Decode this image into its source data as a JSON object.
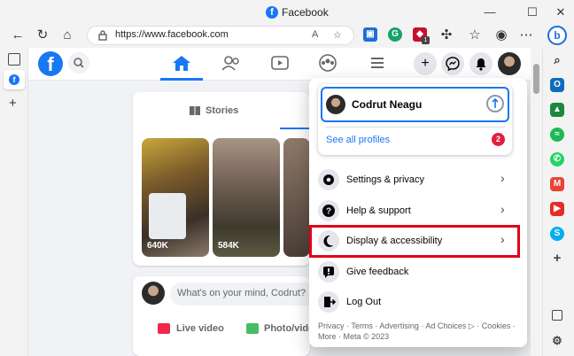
{
  "window": {
    "title": "Facebook",
    "controls": {
      "minimize": "—",
      "maximize": "☐",
      "close": "✕"
    }
  },
  "browser": {
    "url": "https://www.facebook.com",
    "reader_icon": "A",
    "ext_badge": "1"
  },
  "facebook": {
    "logo": "f",
    "stories": {
      "tab_label": "Stories",
      "items": [
        {
          "count": "640K"
        },
        {
          "count": "584K"
        },
        {
          "count": ""
        }
      ]
    },
    "composer": {
      "placeholder": "What's on your mind, Codrut?",
      "live_video": "Live video",
      "photo_video": "Photo/vide"
    }
  },
  "account_menu": {
    "profile_name": "Codrut Neagu",
    "see_all_profiles": "See all profiles",
    "profiles_badge": "2",
    "items": [
      {
        "label": "Settings & privacy"
      },
      {
        "label": "Help & support"
      },
      {
        "label": "Display & accessibility"
      },
      {
        "label": "Give feedback"
      },
      {
        "label": "Log Out"
      }
    ],
    "footer": "Privacy · Terms · Advertising · Ad Choices ▷ · Cookies · More · Meta © 2023"
  },
  "colors": {
    "facebook_blue": "#1877f2",
    "highlight_red": "#e0001a",
    "badge_red": "#e41e3f"
  },
  "icons": [
    "back-arrow-icon",
    "refresh-icon",
    "home-icon",
    "lock-icon",
    "search-icon",
    "friends-icon",
    "watch-icon",
    "groups-icon",
    "menu-icon",
    "plus-icon",
    "messenger-icon",
    "bell-icon",
    "gear-icon",
    "question-icon",
    "moon-icon",
    "feedback-icon",
    "logout-icon",
    "chevron-right-icon"
  ]
}
